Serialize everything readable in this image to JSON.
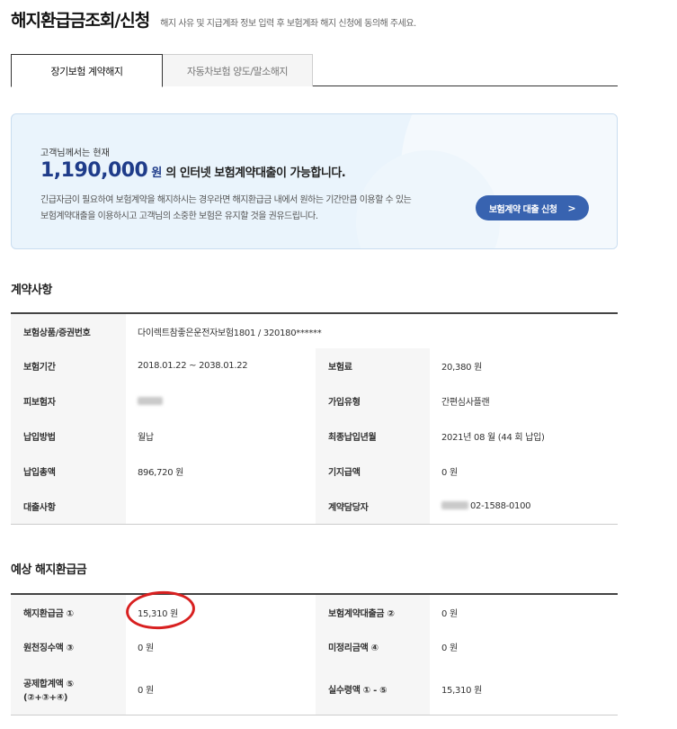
{
  "page": {
    "title": "해지환급금조회/신청",
    "description": "해지 사유 및 지급계좌 정보 입력 후 보험계좌 해지 신청에 동의해 주세요."
  },
  "tabs": [
    {
      "label": "장기보험 계약해지",
      "active": true
    },
    {
      "label": "자동차보험 양도/말소해지",
      "active": false
    }
  ],
  "banner": {
    "small_text": "고객님께서는 현재",
    "amount": "1,190,000",
    "unit": "원",
    "message": "의 인터넷 보험계약대출이 가능합니다.",
    "text_line1": "긴급자금이 필요하여 보험계약을 해지하시는 경우라면 해지환급금 내에서 원하는 기간만큼 이용할 수 있는",
    "text_line2": "보험계약대출을 이용하시고 고객님의 소중한 보험은 유지할 것을 권유드립니다.",
    "button_label": "보험계약 대출 신청",
    "button_icon": "chevron-right-icon"
  },
  "contract": {
    "section_title": "계약사항",
    "product_label": "보험상품/증권번호",
    "product_value": "다이렉트참좋은운전자보험1801 / 320180******",
    "rows": [
      {
        "label1": "보험기간",
        "value1": "2018.01.22 ~ 2038.01.22",
        "label2": "보험료",
        "value2": "20,380 원"
      },
      {
        "label1": "피보험자",
        "value1": "",
        "label2": "가입유형",
        "value2": "간편심사플랜"
      },
      {
        "label1": "납입방법",
        "value1": "월납",
        "label2": "최종납입년월",
        "value2": "2021년 08 월 (44 회 납입)"
      },
      {
        "label1": "납입총액",
        "value1": "896,720 원",
        "label2": "기지급액",
        "value2": "0 원"
      },
      {
        "label1": "대출사항",
        "value1": "",
        "label2": "계약담당자",
        "value2": "02-1588-0100"
      }
    ]
  },
  "refund": {
    "section_title": "예상 해지환급금",
    "rows": [
      {
        "label1": "해지환급금 ①",
        "value1": "15,310 원",
        "label2": "보험계약대출금 ②",
        "value2": "0 원"
      },
      {
        "label1": "원천징수액 ③",
        "value1": "0 원",
        "label2": "미정리금액 ④",
        "value2": "0 원"
      },
      {
        "label1": "공제합계액 ⑤",
        "label1_line2": "(②+③+④)",
        "value1": "0 원",
        "label2": "실수령액 ① - ⑤",
        "value2": "15,310 원"
      }
    ]
  },
  "colors": {
    "accent": "#1f3c8a",
    "button": "#3863b0",
    "banner_bg": "#eaf4fc",
    "annotation": "#d82020"
  }
}
